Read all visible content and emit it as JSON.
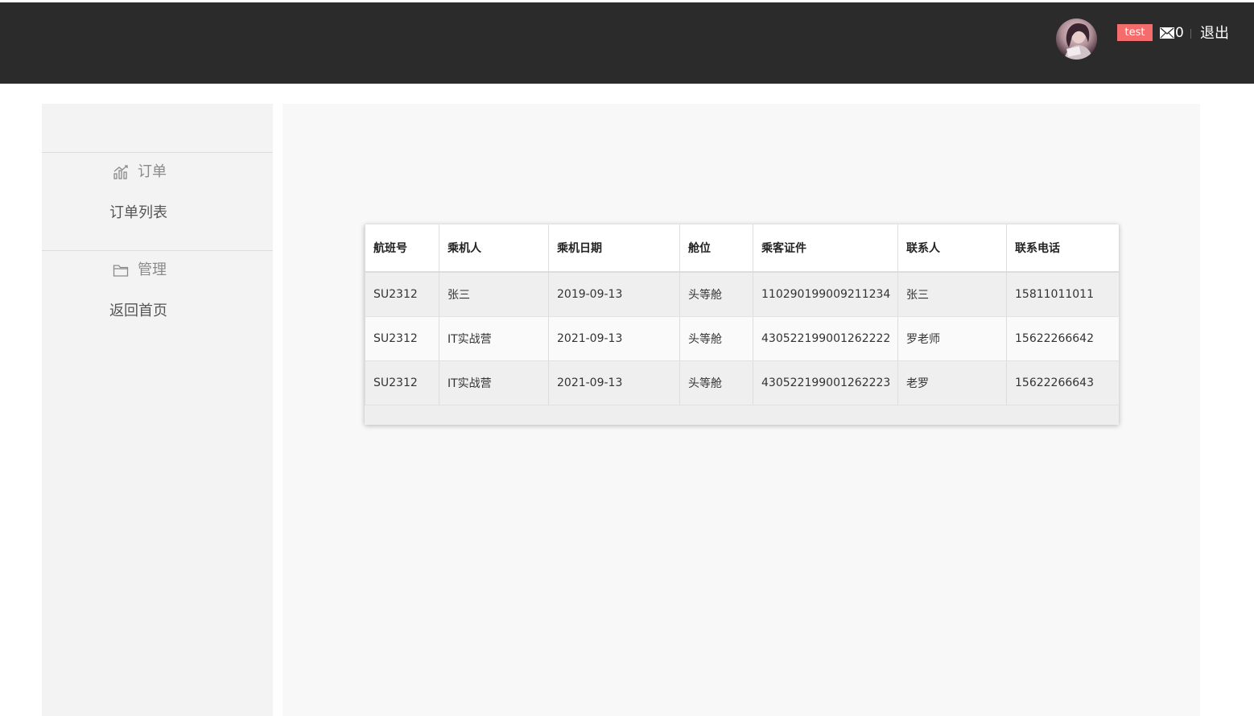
{
  "header": {
    "user_badge": "test",
    "message_count": "0",
    "logout_label": "退出"
  },
  "sidebar": {
    "groups": [
      {
        "icon": "bar-chart-icon",
        "label": "订单",
        "items": [
          {
            "label": "订单列表"
          }
        ]
      },
      {
        "icon": "folder-icon",
        "label": "管理",
        "items": [
          {
            "label": "返回首页"
          }
        ]
      }
    ]
  },
  "table": {
    "columns": [
      "航班号",
      "乘机人",
      "乘机日期",
      "舱位",
      "乘客证件",
      "联系人",
      "联系电话"
    ],
    "rows": [
      [
        "SU2312",
        "张三",
        "2019-09-13",
        "头等舱",
        "110290199009211234",
        "张三",
        "15811011011"
      ],
      [
        "SU2312",
        "IT实战营",
        "2021-09-13",
        "头等舱",
        "430522199001262222",
        "罗老师",
        "15622266642"
      ],
      [
        "SU2312",
        "IT实战营",
        "2021-09-13",
        "头等舱",
        "430522199001262223",
        "老罗",
        "15622266643"
      ]
    ]
  },
  "colors": {
    "header_bg": "#2b2b2b",
    "badge_bg": "#f56c6c",
    "sidebar_bg": "#f3f3f3",
    "main_bg": "#f8f8f8"
  }
}
